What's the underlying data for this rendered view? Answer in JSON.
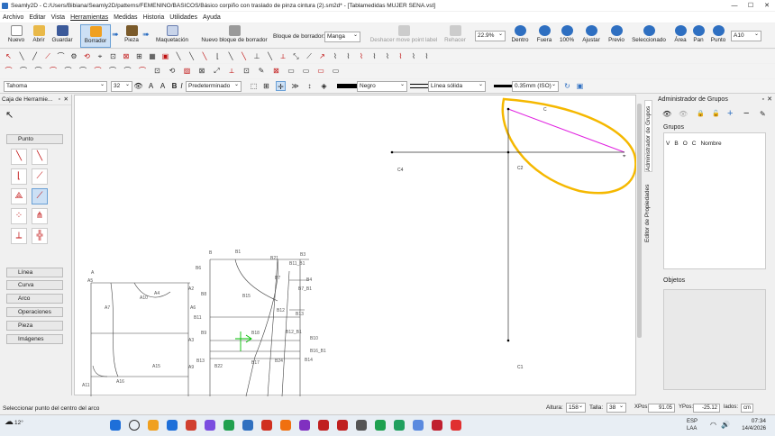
{
  "window": {
    "title": "Seamly2D - C:/Users/Bibiana/Seamly2D/patterns/FEMENINO/BÁSICOS/Básico corpiño con traslado de pinza cintura (2).sm2d* - [Tablamedidas MUJER SENA.vst]",
    "minimize": "—",
    "maximize": "☐",
    "close": "✕"
  },
  "menu": [
    "Archivo",
    "Editar",
    "Vista",
    "Herramientas",
    "Medidas",
    "Historia",
    "Utilidades",
    "Ayuda"
  ],
  "toolbar": {
    "nuevo": "Nuevo",
    "abrir": "Abrir",
    "guardar": "Guardar",
    "borrador": "Borrador",
    "pieza": "Pieza",
    "maquetacion": "Maquetación",
    "nuevo_bloque": "Nuevo bloque de borrador",
    "bloque_label": "Bloque de borrador:",
    "bloque_value": "Manga",
    "deshacer": "Deshacer move point label",
    "rehacer": "Rehacer",
    "zoom_value": "22.9%",
    "dentro": "Dentro",
    "fuera": "Fuera",
    "cien": "100%",
    "ajustar": "Ajustar",
    "previo": "Previo",
    "seleccionado": "Seleccionado",
    "area": "Área",
    "pan": "Pan",
    "punto": "Punto",
    "paper": "A10"
  },
  "format_bar": {
    "font": "Tahoma",
    "size": "32",
    "preset": "Predeterminado",
    "color": "Negro",
    "line_type": "Línea sólida",
    "line_width": "0.35mm (ISO)"
  },
  "left_panel": {
    "title": "Caja de Herramie...",
    "categories": {
      "punto": "Punto",
      "linea": "Línea",
      "curva": "Curva",
      "arco": "Arco",
      "operaciones": "Operaciones",
      "pieza": "Pieza",
      "imagenes": "Imágenes"
    }
  },
  "right_panel": {
    "title": "Administrador de Grupos",
    "grupos_label": "Grupos",
    "columns": [
      "V",
      "B",
      "O",
      "C",
      "Nombre"
    ],
    "objetos_label": "Objetos",
    "tab_groups": "Administrador de Grupos",
    "tab_props": "Editor de Propiedades"
  },
  "canvas": {
    "labels": {
      "c": "C",
      "c2": "C2",
      "c4": "C4",
      "c1": "C1",
      "b": "B",
      "b1": "B1",
      "b21": "B21",
      "b11": "B11",
      "b6": "B6",
      "b5": "B5",
      "b15": "B15",
      "b7": "B7",
      "b4": "B4",
      "b8": "B8",
      "a6": "A6",
      "b9": "B9",
      "b12": "B12",
      "b12_b1": "B12_B1",
      "b10": "B10",
      "b16_b1": "B16_B1",
      "b14": "B14",
      "b13": "B13",
      "b22": "B22",
      "b17": "B17",
      "b24": "B24",
      "b18": "B18",
      "a": "A",
      "a5": "A5",
      "a2": "A2",
      "a4": "A4",
      "a7": "A7",
      "a3": "A3",
      "a8": "A8",
      "a9": "A9",
      "a10": "A10",
      "a15": "A15",
      "a16": "A16",
      "a11": "A11",
      "a6b": "A6",
      "b3": "B3",
      "b7b1": "B7_B1",
      "b11b1": "B11_B1"
    }
  },
  "status": {
    "message": "Seleccionar punto del centro del arco",
    "altura_label": "Altura:",
    "altura": "158",
    "talla_label": "Talla:",
    "talla": "38",
    "xpos_label": "XPos:",
    "xpos": "91.05",
    "ypos_label": "YPos:",
    "ypos": "-25.12",
    "lados_label": "lados:",
    "units": "cm"
  },
  "taskbar": {
    "temp": "12°",
    "lang1": "ESP",
    "lang2": "LAA",
    "time": "07:34",
    "date": "14/4/2026"
  },
  "colors": {
    "accent": "#2e6fc1",
    "highlight": "#f5b800",
    "magenta": "#e020e0",
    "green": "#00c000"
  }
}
